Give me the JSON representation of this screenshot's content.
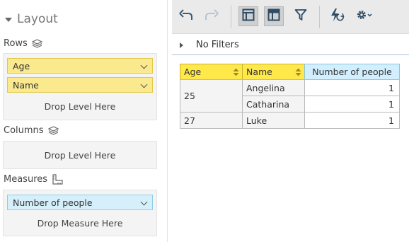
{
  "layout": {
    "title": "Layout",
    "rows": {
      "label": "Rows",
      "items": [
        "Age",
        "Name"
      ],
      "drop_text": "Drop Level Here"
    },
    "columns": {
      "label": "Columns",
      "drop_text": "Drop Level Here"
    },
    "measures": {
      "label": "Measures",
      "items": [
        "Number of people"
      ],
      "drop_text": "Drop Measure Here"
    }
  },
  "toolbar": {
    "buttons": [
      {
        "name": "undo",
        "icon": "undo-icon",
        "enabled": true
      },
      {
        "name": "redo",
        "icon": "redo-icon",
        "enabled": false
      },
      {
        "name": "compact-layout",
        "icon": "compact-layout-icon",
        "active": true
      },
      {
        "name": "tabular-layout",
        "icon": "tabular-layout-icon",
        "active": true
      },
      {
        "name": "filter",
        "icon": "filter-icon"
      },
      {
        "name": "refresh",
        "icon": "lightning-refresh-icon"
      },
      {
        "name": "settings",
        "icon": "gear-icon"
      }
    ]
  },
  "filters": {
    "label": "No Filters"
  },
  "grid": {
    "headers": [
      "Age",
      "Name",
      "Number of people"
    ],
    "groups": [
      {
        "age": "25",
        "rows": [
          {
            "name": "Angelina",
            "value": "1"
          },
          {
            "name": "Catharina",
            "value": "1"
          }
        ]
      },
      {
        "age": "27",
        "rows": [
          {
            "name": "Luke",
            "value": "1"
          }
        ]
      }
    ]
  },
  "colors": {
    "level_item_bg": "#fbe98e",
    "measure_item_bg": "#d6f0fb",
    "header_yellow": "#ffe84a",
    "header_blue": "#d2efff",
    "toolbar_icon": "#3a5a76"
  }
}
